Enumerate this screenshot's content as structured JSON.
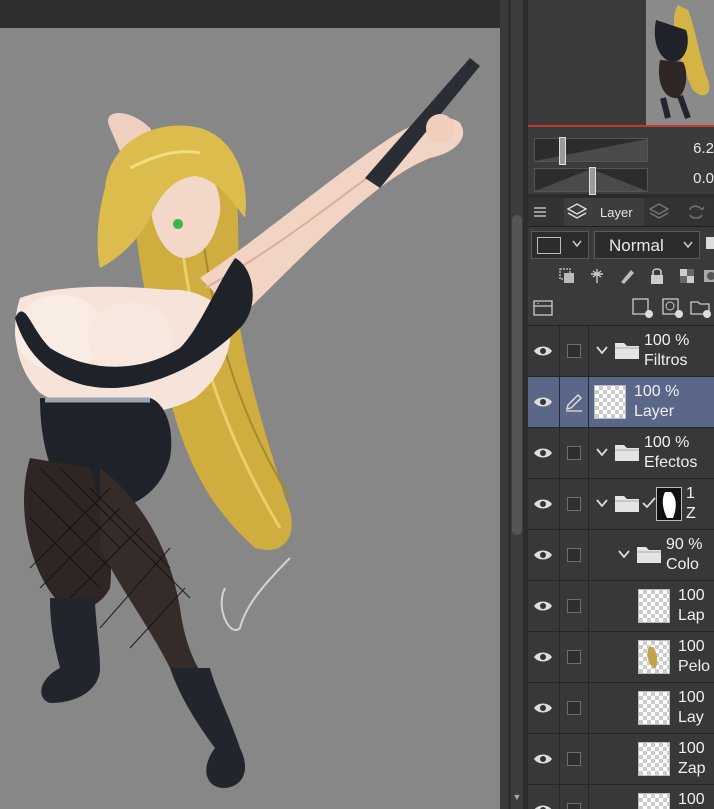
{
  "slider_values": [
    "6.2",
    "0.0"
  ],
  "tabs": {
    "layer_label": "Layer"
  },
  "blend_mode": "Normal",
  "layers": [
    {
      "opacity": "100 %",
      "name": "Filtros",
      "type": "folder",
      "expanded": true,
      "indent": 0
    },
    {
      "opacity": "100 %",
      "name": "Layer",
      "type": "raster",
      "selected": true,
      "indent": 0
    },
    {
      "opacity": "100 %",
      "name": "Efectos",
      "type": "folder",
      "expanded": true,
      "indent": 0
    },
    {
      "opacity": "1",
      "name": "Z",
      "type": "folder-mask",
      "expanded": true,
      "indent": 0
    },
    {
      "opacity": "90 %",
      "name": "Colo",
      "type": "folder",
      "expanded": true,
      "indent": 1
    },
    {
      "opacity": "100",
      "name": "Lap",
      "type": "raster",
      "indent": 2
    },
    {
      "opacity": "100",
      "name": "Pelo",
      "type": "raster-hair",
      "indent": 2
    },
    {
      "opacity": "100",
      "name": "Lay",
      "type": "raster",
      "indent": 2
    },
    {
      "opacity": "100",
      "name": "Zap",
      "type": "raster",
      "indent": 2
    },
    {
      "opacity": "100",
      "name": "",
      "type": "raster",
      "indent": 2
    }
  ],
  "colors": {
    "canvas_bg": "#878787",
    "selected_row": "#5a6788",
    "hair": "#d6b84a",
    "outfit": "#1f2228"
  }
}
